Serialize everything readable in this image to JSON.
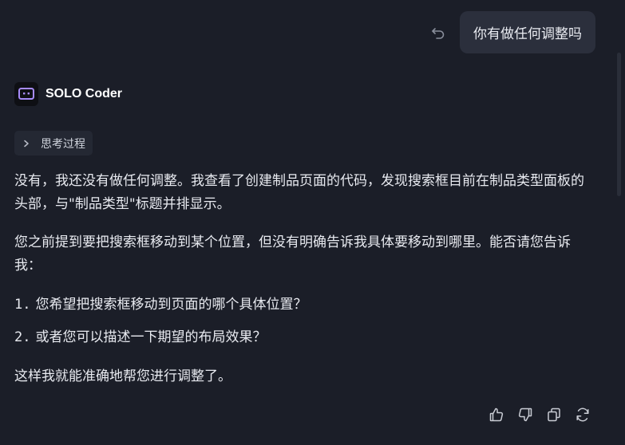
{
  "user_message": {
    "text": "你有做任何调整吗"
  },
  "agent": {
    "name": "SOLO Coder",
    "thinking_label": "思考过程"
  },
  "response": {
    "paragraph1": "没有，我还没有做任何调整。我查看了创建制品页面的代码，发现搜索框目前在制品类型面板的头部，与\"制品类型\"标题并排显示。",
    "paragraph2": "您之前提到要把搜索框移动到某个位置，但没有明确告诉我具体要移动到哪里。能否请您告诉我：",
    "list": [
      {
        "num": "1.",
        "text": "您希望把搜索框移动到页面的哪个具体位置？"
      },
      {
        "num": "2.",
        "text": "或者您可以描述一下期望的布局效果？"
      }
    ],
    "paragraph3": "这样我就能准确地帮您进行调整了。"
  },
  "icons": {
    "undo": "undo-icon",
    "avatar": "robot-icon",
    "chevron": "chevron-right-icon",
    "thumbs_up": "thumbs-up-icon",
    "thumbs_down": "thumbs-down-icon",
    "copy": "copy-icon",
    "regenerate": "refresh-icon"
  },
  "colors": {
    "background": "#1b1e28",
    "bubble": "#2b2f3c",
    "accent": "#a78bfa"
  }
}
